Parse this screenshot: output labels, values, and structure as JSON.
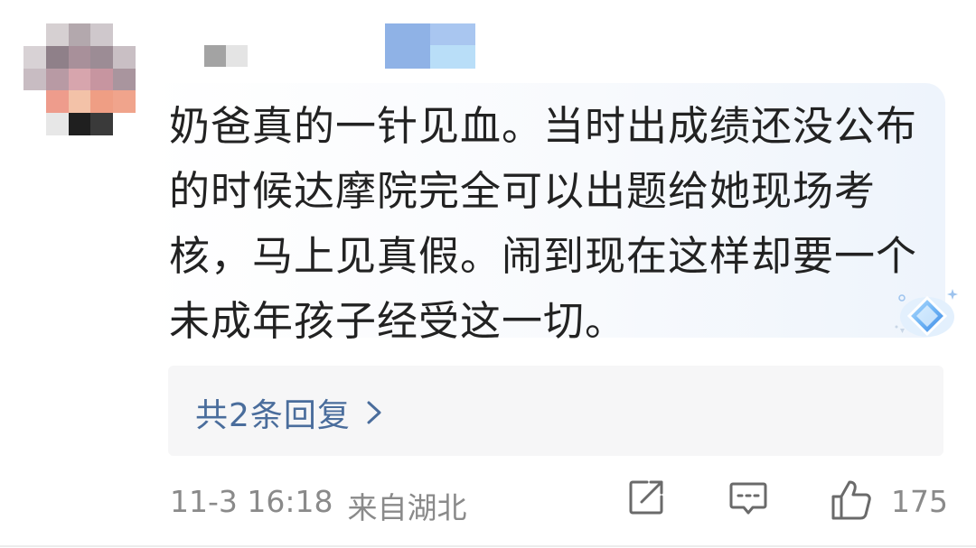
{
  "comment": {
    "text": "奶爸真的一针见血。当时出成绩还没公布的时候达摩院完全可以出题给她现场考核，马上见真假。闹到现在这样却要一个未成年孩子经受这一切。"
  },
  "replies": {
    "label": "共2条回复"
  },
  "meta": {
    "timestamp": "11-3 16:18",
    "location": "来自湖北"
  },
  "actions": {
    "share_icon": "share-icon",
    "comment_icon": "comment-icon",
    "like_icon": "thumbs-up-icon",
    "like_count": "175"
  },
  "colors": {
    "text": "#222222",
    "link": "#4a6d9c",
    "meta": "#8a8a8a",
    "reply_bg": "#f6f6f7"
  }
}
